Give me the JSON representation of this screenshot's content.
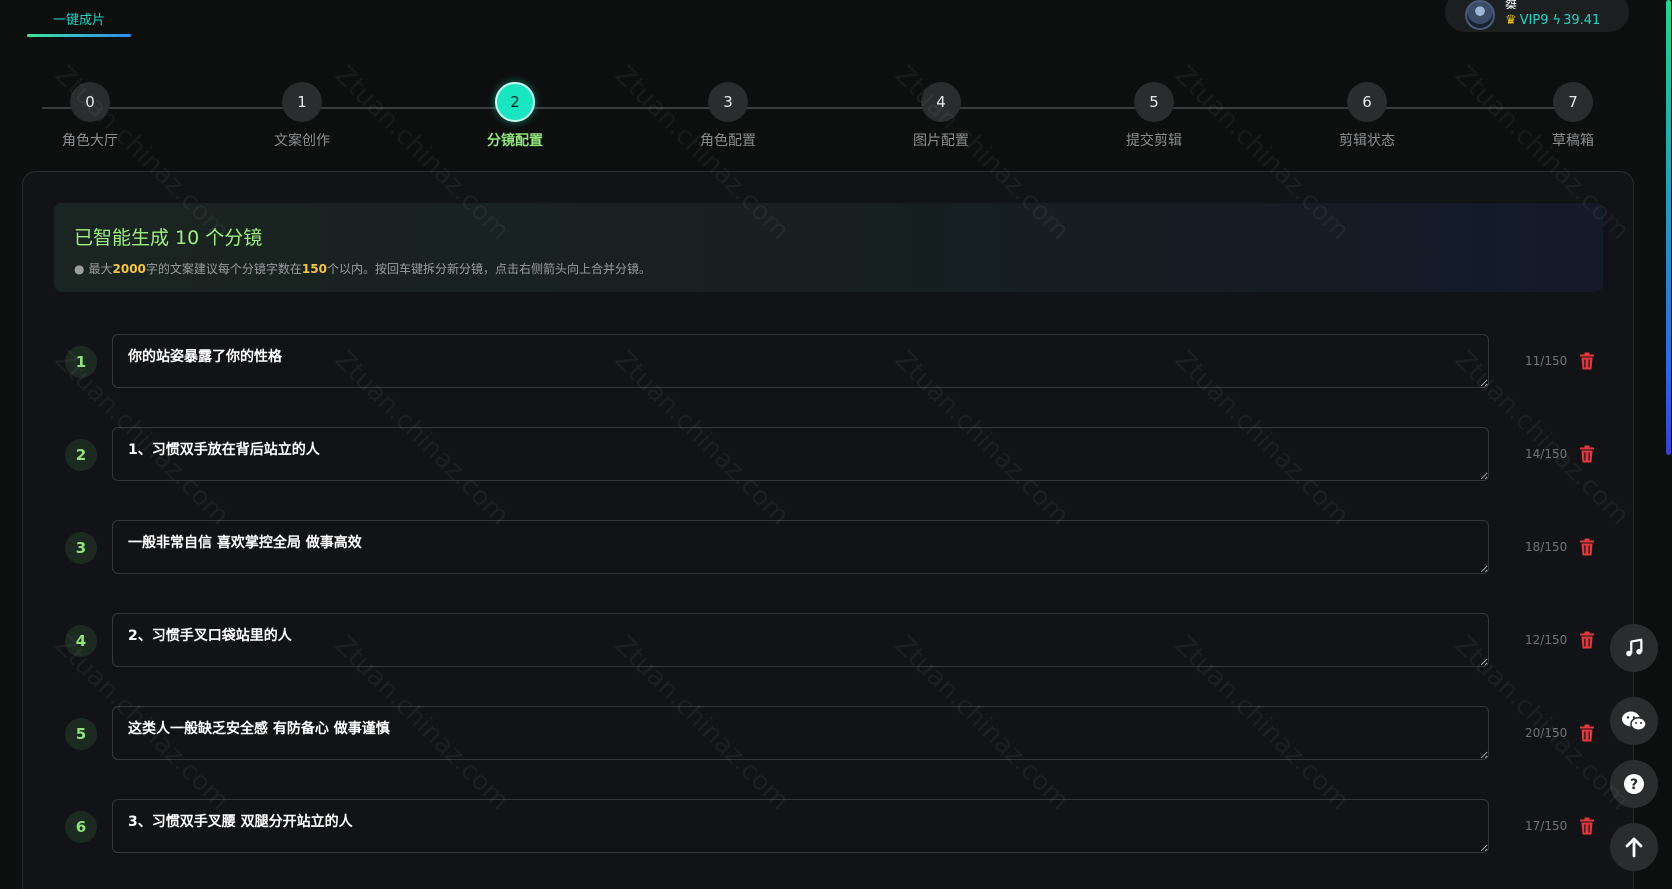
{
  "top_tab": {
    "label": "一键成片"
  },
  "user": {
    "name": "桀",
    "vip": "VIP9",
    "balance": "39.41"
  },
  "stepper": {
    "active_index": 2,
    "steps": [
      {
        "num": "0",
        "label": "角色大厅"
      },
      {
        "num": "1",
        "label": "文案创作"
      },
      {
        "num": "2",
        "label": "分镜配置"
      },
      {
        "num": "3",
        "label": "角色配置"
      },
      {
        "num": "4",
        "label": "图片配置"
      },
      {
        "num": "5",
        "label": "提交剪辑"
      },
      {
        "num": "6",
        "label": "剪辑状态"
      },
      {
        "num": "7",
        "label": "草稿箱"
      }
    ]
  },
  "info": {
    "title": "已智能生成 10 个分镜",
    "tip_prefix": "最大",
    "tip_max_chars": "2000",
    "tip_middle": "字的文案建议每个分镜字数在",
    "tip_per_segment": "150",
    "tip_suffix": "个以内。按回车键拆分新分镜，点击右侧箭头向上合并分镜。"
  },
  "segments": [
    {
      "index": "1",
      "text": "你的站姿暴露了你的性格",
      "count": "11/150"
    },
    {
      "index": "2",
      "text": "1、习惯双手放在背后站立的人",
      "count": "14/150"
    },
    {
      "index": "3",
      "text": "一般非常自信 喜欢掌控全局 做事高效",
      "count": "18/150"
    },
    {
      "index": "4",
      "text": "2、习惯手叉口袋站里的人",
      "count": "12/150"
    },
    {
      "index": "5",
      "text": "这类人一般缺乏安全感 有防备心 做事谨慎",
      "count": "20/150"
    },
    {
      "index": "6",
      "text": "3、习惯双手叉腰 双腿分开站立的人",
      "count": "17/150"
    }
  ],
  "watermark": "Ztuan.chinaz.com",
  "colors": {
    "accent": "#19e6c1",
    "active_label": "#8fe37a",
    "highlight": "#f5c542",
    "danger": "#e0383e"
  }
}
